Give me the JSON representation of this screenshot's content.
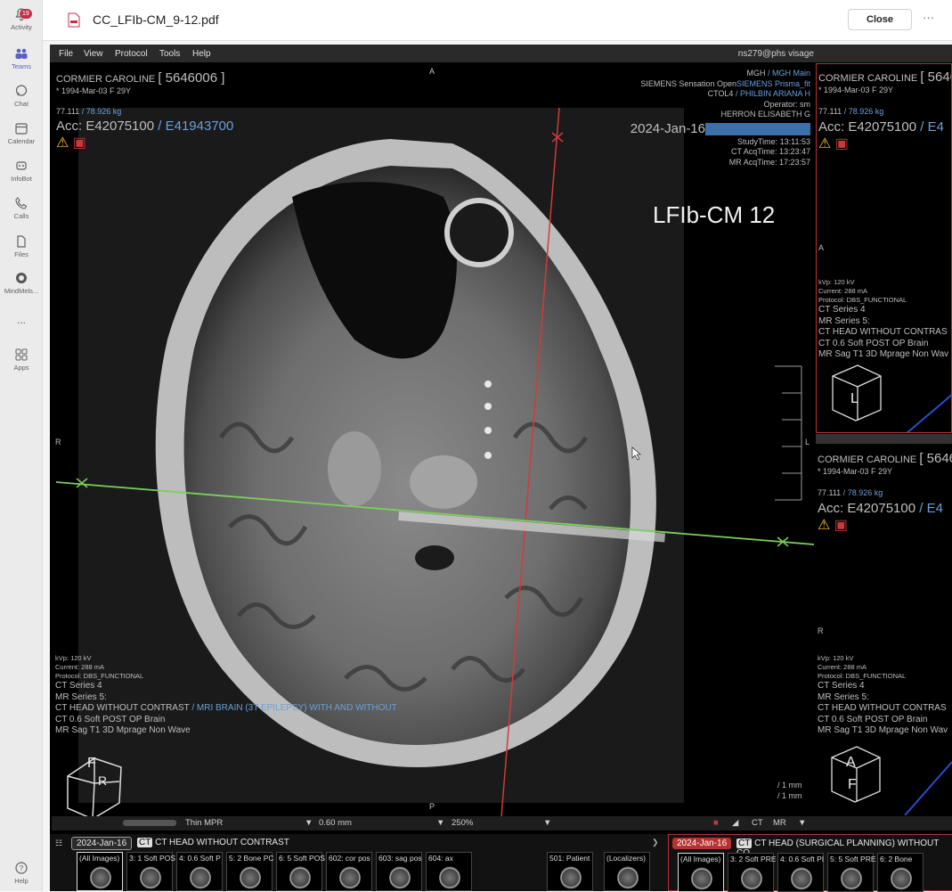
{
  "rail": {
    "activity": {
      "label": "Activity",
      "badge": "19"
    },
    "teams": {
      "label": "Teams"
    },
    "chat": {
      "label": "Chat"
    },
    "calendar": {
      "label": "Calendar"
    },
    "infobot": {
      "label": "InfoBot"
    },
    "calls": {
      "label": "Calls"
    },
    "files": {
      "label": "Files"
    },
    "mindmels": {
      "label": "MindMels..."
    },
    "more": {
      "label": "..."
    },
    "apps": {
      "label": "Apps"
    },
    "help": {
      "label": "Help"
    }
  },
  "topbar": {
    "title": "CC_LFIb-CM_9-12.pdf",
    "close_label": "Close",
    "more_label": "···"
  },
  "viewer": {
    "menu": [
      "File",
      "View",
      "Protocol",
      "Tools",
      "Help"
    ],
    "user": "ns279@phs  visage",
    "main": {
      "patient_name": "CORMIER CAROLINE",
      "patient_id": "[ 5646006 ]",
      "dob": "* 1994-Mar-03 F 29Y",
      "weight_a": "77.111",
      "weight_b": "/ 78.926 kg",
      "acc_a": "Acc: E42075100",
      "acc_b": "/ E41943700",
      "inst_a": "MGH",
      "inst_b": "/ MGH Main",
      "scanner_a": "SIEMENS Sensation Open",
      "scanner_b": "SIEMENS Prisma_fit",
      "ref_a": "CTOL4",
      "ref_b": "/ PHILBIN ARIANA H",
      "operator": "Operator: sm",
      "physician": "HERRON ELISABETH G",
      "date": "2024-Jan-16",
      "study_time": "StudyTime: 13:11:53",
      "ct_acq": "CT AcqTime: 13:23:47",
      "mr_acq": "MR AcqTime: 17:23:57",
      "annotation": "LFIb-CM 12",
      "orient_top": "A",
      "orient_bottom": "P",
      "orient_left": "R",
      "orient_right": "L",
      "kvp": "kVp: 120 kV",
      "current": "Current: 288 mA",
      "protocol": "Protocol: DBS_FUNCTIONAL",
      "ct_series": "CT Series 4",
      "mr_series": "MR Series 5:",
      "desc_a": "CT HEAD WITHOUT CONTRAST",
      "desc_b": "/ MRI BRAIN (3T EPILEPSY) WITH AND WITHOUT",
      "ct_desc": "CT 0.6 Soft POST OP Brain",
      "mr_desc": "MR Sag T1 3D Mprage Non Wave",
      "scale_a": "/ 1 mm",
      "scale_b": "/ 1 mm",
      "cube_a": "F",
      "cube_b": "R"
    },
    "right_top": {
      "patient_name": "CORMIER CAROLINE",
      "patient_id": "[ 5646",
      "dob": "* 1994-Mar-03 F 29Y",
      "weight_a": "77.111",
      "weight_b": "/ 78.926 kg",
      "acc_a": "Acc: E42075100",
      "acc_b": "/ E4",
      "orient": "A",
      "kvp": "kVp: 120 kV",
      "current": "Current: 288 mA",
      "protocol": "Protocol: DBS_FUNCTIONAL",
      "ct_series": "CT Series 4",
      "mr_series": "MR Series 5:",
      "desc": "CT HEAD WITHOUT CONTRAS",
      "ct_desc": "CT 0.6 Soft POST OP Brain",
      "mr_desc": "MR Sag T1 3D Mprage Non Wav",
      "cube": "L"
    },
    "right_bottom": {
      "patient_name": "CORMIER CAROLINE",
      "patient_id": "[ 5646",
      "dob": "* 1994-Mar-03 F 29Y",
      "weight_a": "77.111",
      "weight_b": "/ 78.926 kg",
      "acc_a": "Acc: E42075100",
      "acc_b": "/ E4",
      "orient": "R",
      "kvp": "kVp: 120 kV",
      "current": "Current: 288 mA",
      "protocol": "Protocol: DBS_FUNCTIONAL",
      "ct_series": "CT Series 4",
      "mr_series": "MR Series 5:",
      "desc": "CT HEAD WITHOUT CONTRAS",
      "ct_desc": "CT 0.6 Soft POST OP Brain",
      "mr_desc": "MR Sag T1 3D Mprage Non Wav",
      "cube_a": "A",
      "cube_b": "F"
    },
    "status": {
      "mode": "Thin MPR",
      "thickness": "0.60 mm",
      "zoom": "250%",
      "modality_a": "CT",
      "modality_b": "MR"
    },
    "thumbs": {
      "date_a": "2024-Jan-16",
      "series_tag": "CT",
      "series_a": "CT HEAD WITHOUT CONTRAST",
      "date_b": "2024-Jan-16",
      "series_b": "CT HEAD (SURGICAL PLANNING) WITHOUT CO",
      "left": [
        "(All Images)",
        "3: 1 Soft POS",
        "4: 0.6 Soft P",
        "5: 2 Bone PC",
        "6: 5 Soft POS",
        "602: cor pos",
        "603: sag pos",
        "604: ax",
        "501: Patient",
        "(Localizers)"
      ],
      "right": [
        "(All Images)",
        "3: 2 Soft PRE",
        "4: 0.6 Soft PI",
        "5: 5 Soft PRE",
        "6: 2 Bone"
      ]
    }
  }
}
